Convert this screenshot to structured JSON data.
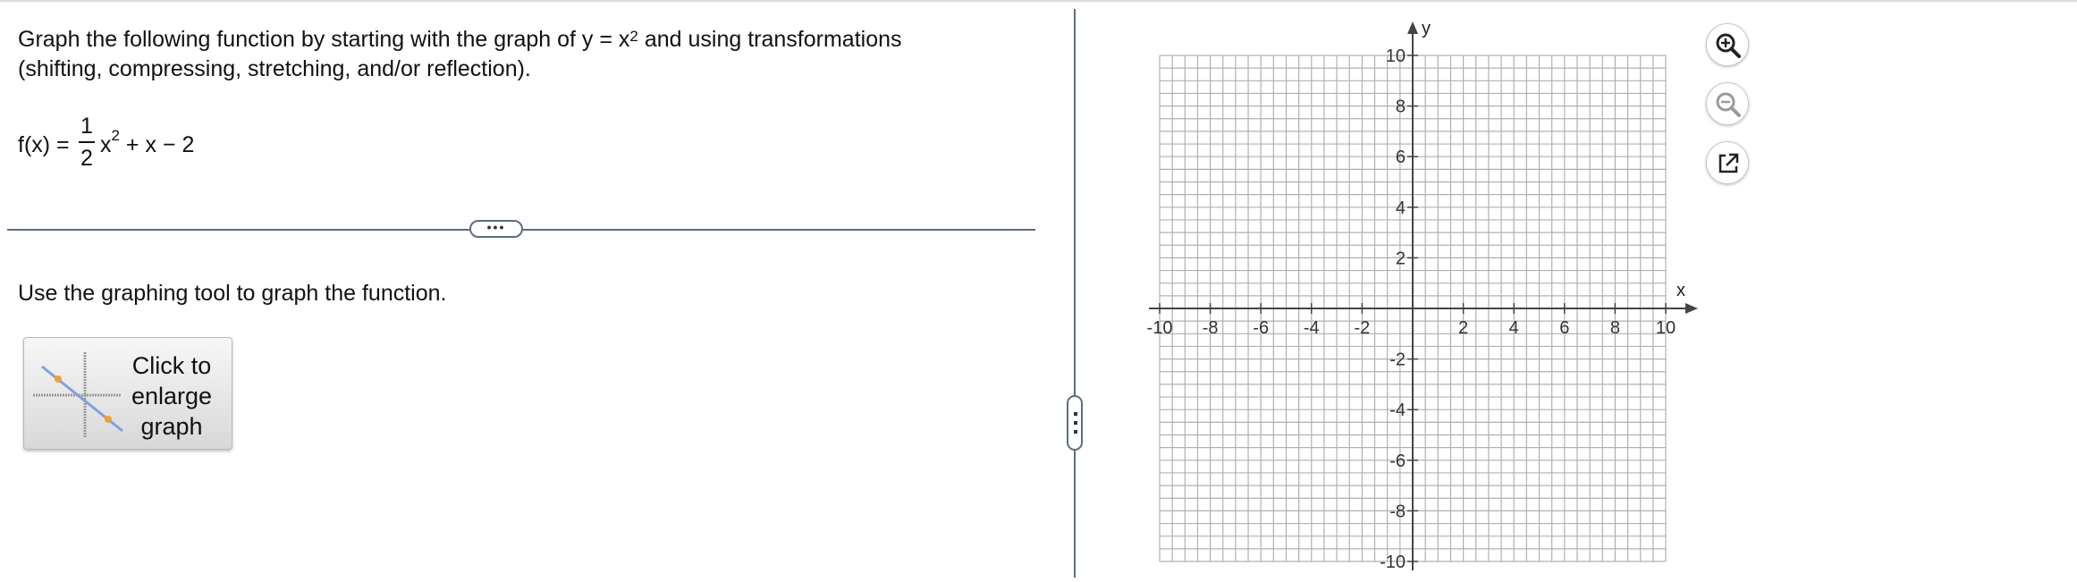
{
  "question": {
    "instruction_part1": "Graph the following function by starting with the graph of y = x",
    "instruction_exp": "2",
    "instruction_part2": " and using transformations",
    "instruction_line2": "(shifting, compressing, stretching, and/or reflection).",
    "function": {
      "lhs": "f(x) =",
      "numerator": "1",
      "denominator": "2",
      "var": "x",
      "exp": "2",
      "rest": " + x − 2"
    },
    "more_label": "•••",
    "prompt": "Use the graphing tool to graph the function."
  },
  "enlarge_button": {
    "line1": "Click to",
    "line2": "enlarge",
    "line3": "graph"
  },
  "graph": {
    "x_label": "x",
    "y_label": "y",
    "xlim": [
      -10,
      10
    ],
    "ylim": [
      -10,
      10
    ],
    "grid_step": 0.5,
    "x_tick_labels": [
      "-10",
      "-8",
      "-6",
      "-4",
      "-2",
      "2",
      "4",
      "6",
      "8",
      "10"
    ],
    "y_tick_labels": [
      "10",
      "8",
      "6",
      "4",
      "2",
      "-2",
      "-4",
      "-6",
      "-8",
      "-10"
    ],
    "grid_color": "#b0b0b0",
    "axis_color": "#444444"
  },
  "tools": {
    "zoom_in": "magnifier-plus-icon",
    "zoom_out": "magnifier-minus-icon",
    "popout": "popout-icon"
  },
  "colors": {
    "accent": "#5e6b87",
    "thumb_point": "#f0a030",
    "thumb_line": "#7fa0e0"
  }
}
